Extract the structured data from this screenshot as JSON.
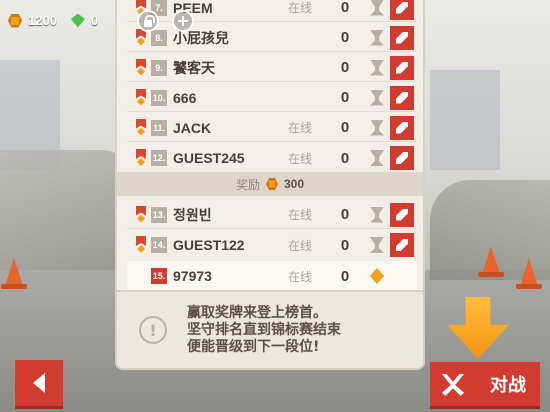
{
  "currency": {
    "coins": "1200",
    "gems": "0",
    "coin_icon": "coin-icon",
    "gem_icon": "gem-icon"
  },
  "colors": {
    "accent": "#d23b30",
    "panel": "#f3eee8",
    "orange": "#f2a01b"
  },
  "leaderboard": {
    "rows_top": [
      {
        "rank": "7.",
        "name": "PEEM",
        "status": "在线",
        "score": "0"
      },
      {
        "rank": "8.",
        "name": "小屁孩兒",
        "status": "",
        "score": "0"
      },
      {
        "rank": "9.",
        "name": "饕客天",
        "status": "",
        "score": "0"
      },
      {
        "rank": "10.",
        "name": "666",
        "status": "",
        "score": "0"
      },
      {
        "rank": "11.",
        "name": "JACK",
        "status": "在线",
        "score": "0"
      },
      {
        "rank": "12.",
        "name": "GUEST245",
        "status": "在线",
        "score": "0"
      }
    ],
    "reward_label": "奖励",
    "reward_value": "300",
    "rows_bottom": [
      {
        "rank": "13.",
        "name": "정원빈",
        "status": "在线",
        "score": "0"
      },
      {
        "rank": "14.",
        "name": "GUEST122",
        "status": "在线",
        "score": "0"
      }
    ],
    "me": {
      "rank": "15.",
      "name": "97973",
      "status": "在线",
      "score": "0"
    }
  },
  "info": {
    "line1": "赢取奖牌来登上榜首。",
    "line2": "坚守排名直到锦标赛结束",
    "line3": "便能晋级到下一段位!"
  },
  "buttons": {
    "battle": "对战"
  }
}
